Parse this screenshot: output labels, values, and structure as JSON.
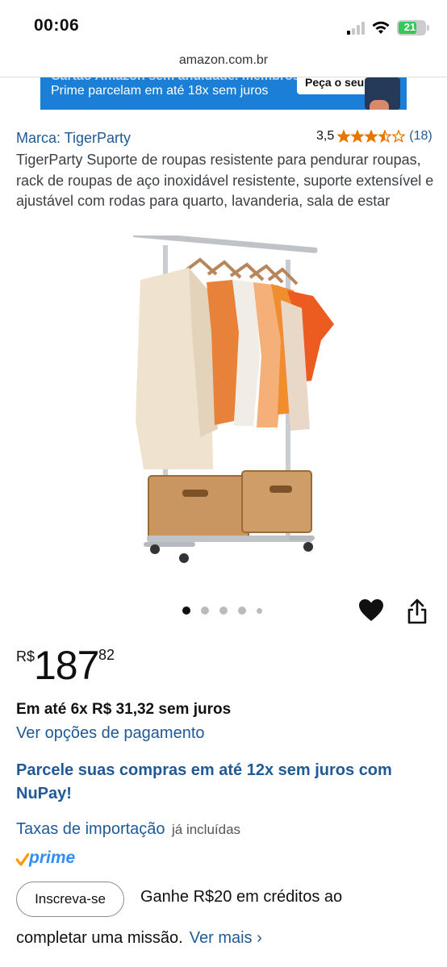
{
  "status_bar": {
    "time": "00:06",
    "battery": "21"
  },
  "url_bar": {
    "url": "amazon.com.br"
  },
  "banner": {
    "line1": "Cartão Amazon sem anuidade. membros",
    "line2": "Prime parcelam em até 18x sem juros",
    "button": "Peça o seu"
  },
  "product": {
    "brand": "Marca: TigerParty",
    "rating_value": "3,5",
    "rating_stars": 3.5,
    "rating_count": "(18)",
    "title": "TigerParty Suporte de roupas resistente para pendurar roupas, rack de roupas de aço inoxidável resistente, suporte extensível e ajustável com rodas para quarto, lavanderia, sala de estar",
    "image_icon": "clothing-rack-image"
  },
  "carousel": {
    "dots": 5,
    "active_index": 0
  },
  "price": {
    "symbol": "R$",
    "whole": "187",
    "fraction": "82"
  },
  "installments": "Em até 6x R$ 31,32 sem juros",
  "payment_link": "Ver opções de pagamento",
  "nupay": "Parcele suas compras em até 12x sem juros com NuPay!",
  "import_fees": {
    "link": "Taxas de importação",
    "note": "já incluídas"
  },
  "prime": {
    "label": "prime"
  },
  "promo": {
    "button": "Inscreva-se",
    "line1": "Ganhe R$20 em créditos ao",
    "line2": "completar uma missão.",
    "see_more": "Ver mais ›"
  },
  "colors": {
    "link": "#1f5a96",
    "star": "#e77600",
    "banner": "#1b7fd7",
    "prime_blue": "#2f8ff5",
    "prime_check": "#ff9900"
  }
}
